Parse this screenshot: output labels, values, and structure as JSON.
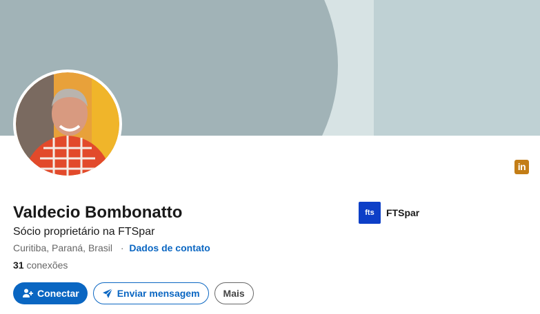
{
  "profile": {
    "name": "Valdecio Bombonatto",
    "headline": "Sócio proprietário na FTSpar",
    "location": "Curitiba, Paraná, Brasil",
    "location_separator": "·",
    "contact_link": "Dados de contato",
    "connections_count": "31",
    "connections_label": "conexões"
  },
  "company": {
    "logo_text": "fts",
    "name": "FTSpar"
  },
  "badge": {
    "text": "in"
  },
  "actions": {
    "connect": "Conectar",
    "message": "Enviar mensagem",
    "more": "Mais"
  },
  "icons": {
    "connect": "add-person-icon",
    "message": "send-icon",
    "badge": "linkedin-icon"
  },
  "colors": {
    "primary": "#0a66c2",
    "banner": "#bfd1d4",
    "banner_curve": "#a1b3b7",
    "company_logo": "#0d3fc7",
    "badge": "#c37d16"
  }
}
